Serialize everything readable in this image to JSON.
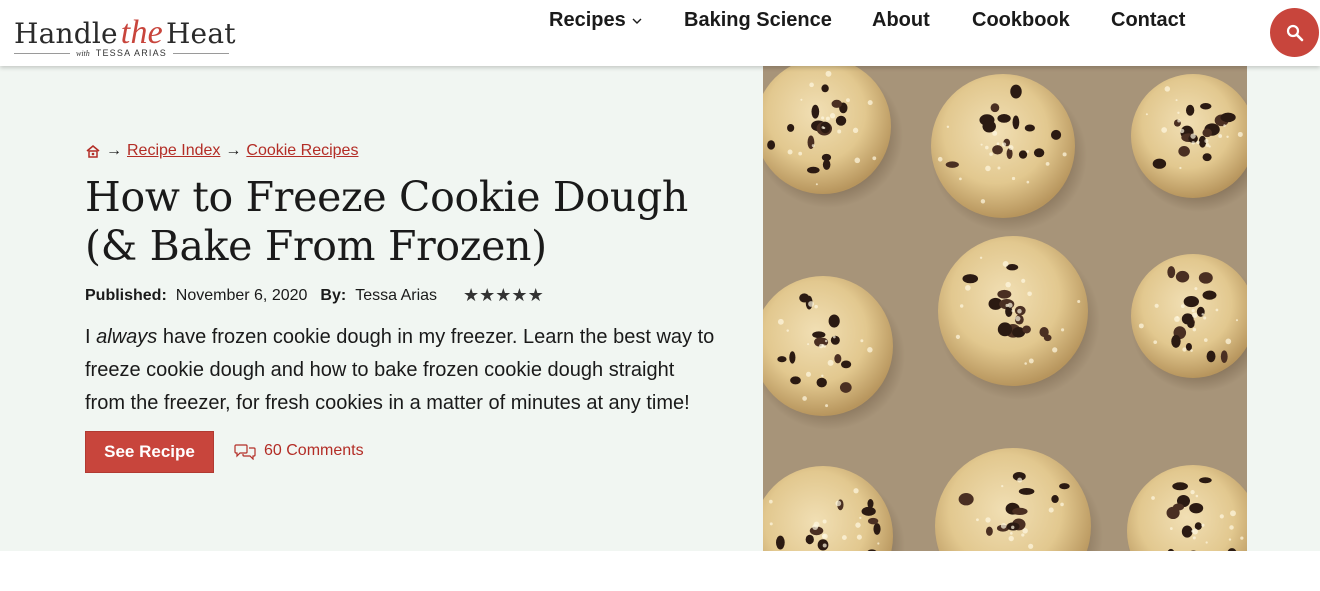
{
  "logo": {
    "main_before": "Handle",
    "main_accent": "the",
    "main_after": "Heat",
    "sub_with": "with",
    "sub_name": "TESSA ARIAS"
  },
  "nav": {
    "recipes": "Recipes",
    "baking_science": "Baking Science",
    "about": "About",
    "cookbook": "Cookbook",
    "contact": "Contact"
  },
  "breadcrumb": {
    "home_icon": "home-icon",
    "recipe_index": "Recipe Index",
    "cookie_recipes": "Cookie Recipes"
  },
  "post": {
    "title": "How to Freeze Cookie Dough (& Bake From Frozen)",
    "published_label": "Published:",
    "published_date": "November 6, 2020",
    "by_label": "By:",
    "author": "Tessa Arias",
    "rating": 5,
    "stars": "★★★★★",
    "desc_before": "I ",
    "desc_em": "always",
    "desc_after": " have frozen cookie dough in my freezer. Learn the best way to freeze cookie dough and how to bake frozen cookie dough straight from the freezer, for fresh cookies in a matter of minutes at any time!",
    "see_recipe": "See Recipe",
    "comments": "60 Comments"
  },
  "colors": {
    "accent": "#c8453c",
    "hero_bg": "#f1f6f2",
    "link": "#b32d26"
  }
}
